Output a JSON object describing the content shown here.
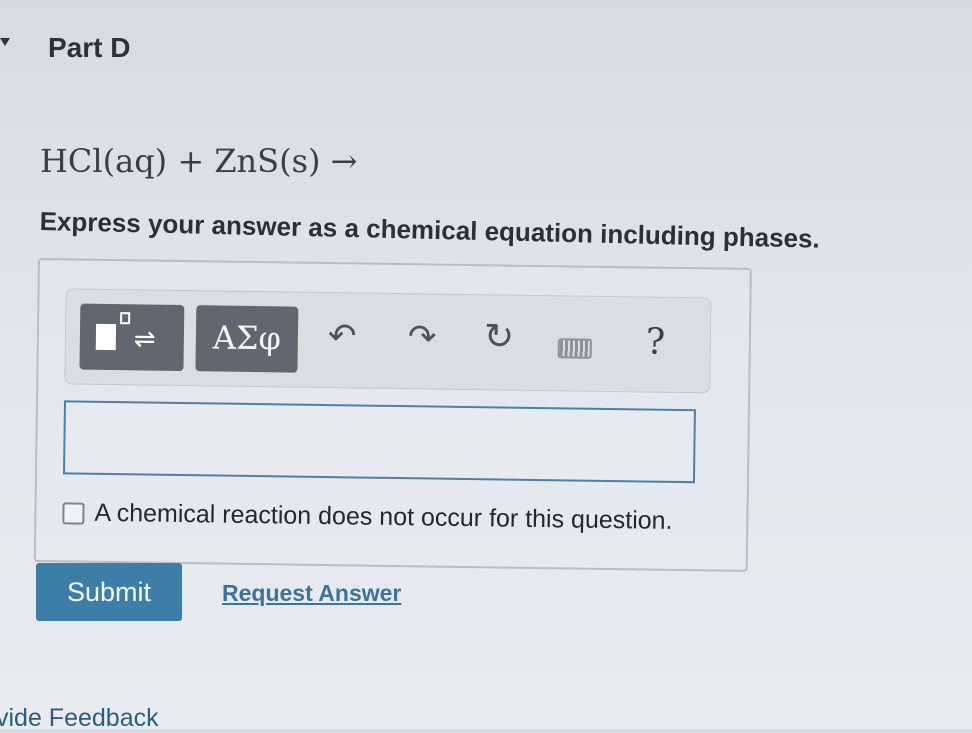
{
  "part": {
    "title": "Part D"
  },
  "question": {
    "equation": "HCl(aq) + ZnS(s) →",
    "instruction": "Express your answer as a chemical equation including phases."
  },
  "toolbar": {
    "templates_icon": "templates-reaction-arrow-icon",
    "greek_label": "ΑΣφ",
    "undo_icon": "undo-icon",
    "redo_icon": "redo-icon",
    "reset_icon": "reset-icon",
    "keyboard_icon": "keyboard-icon",
    "help_label": "?"
  },
  "answer": {
    "value": "",
    "no_reaction_label": "A chemical reaction does not occur for this question.",
    "no_reaction_checked": false
  },
  "actions": {
    "submit_label": "Submit",
    "request_answer_label": "Request Answer",
    "feedback_label": "vide Feedback"
  },
  "colors": {
    "accent": "#3c7ea7",
    "link": "#3b7399",
    "toolbar_button": "#5f6770"
  }
}
